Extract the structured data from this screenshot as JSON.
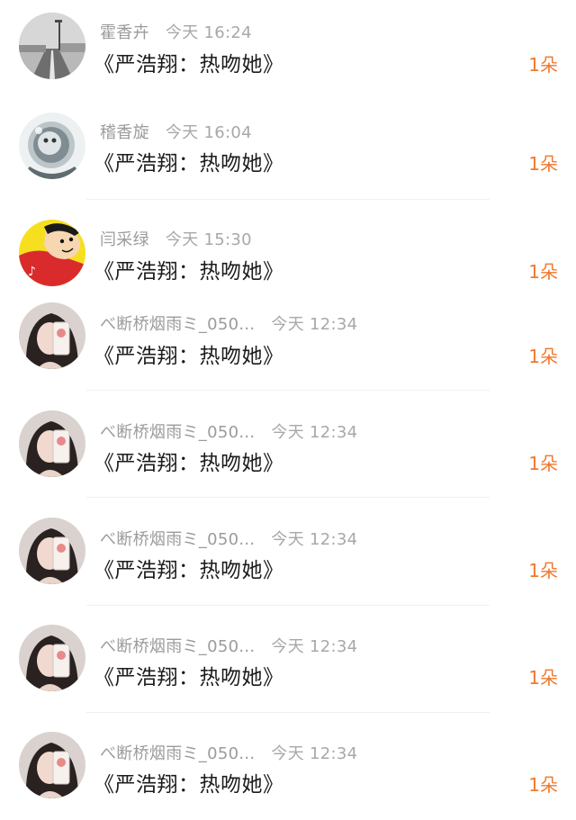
{
  "accent_color": "#f0782d",
  "gift_list": [
    {
      "name": "霍香卉",
      "time": "今天 16:24",
      "title": "《严浩翔：热吻她》",
      "count": "1朵",
      "avatar": "road-photo"
    },
    {
      "name": "稽香旋",
      "time": "今天 16:04",
      "title": "《严浩翔：热吻她》",
      "count": "1朵",
      "avatar": "astronaut-helmet"
    },
    {
      "name": "闫采绿",
      "time": "今天 15:30",
      "title": "《严浩翔：热吻她》",
      "count": "1朵",
      "avatar": "cartoon-character"
    },
    {
      "name": "べ断桥烟雨ミ_050...",
      "time": "今天 12:34",
      "title": "《严浩翔：热吻她》",
      "count": "1朵",
      "avatar": "girl-selfie"
    },
    {
      "name": "べ断桥烟雨ミ_050...",
      "time": "今天 12:34",
      "title": "《严浩翔：热吻她》",
      "count": "1朵",
      "avatar": "girl-selfie"
    },
    {
      "name": "べ断桥烟雨ミ_050...",
      "time": "今天 12:34",
      "title": "《严浩翔：热吻她》",
      "count": "1朵",
      "avatar": "girl-selfie"
    },
    {
      "name": "べ断桥烟雨ミ_050...",
      "time": "今天 12:34",
      "title": "《严浩翔：热吻她》",
      "count": "1朵",
      "avatar": "girl-selfie"
    },
    {
      "name": "べ断桥烟雨ミ_050...",
      "time": "今天 12:34",
      "title": "《严浩翔：热吻她》",
      "count": "1朵",
      "avatar": "girl-selfie"
    }
  ]
}
